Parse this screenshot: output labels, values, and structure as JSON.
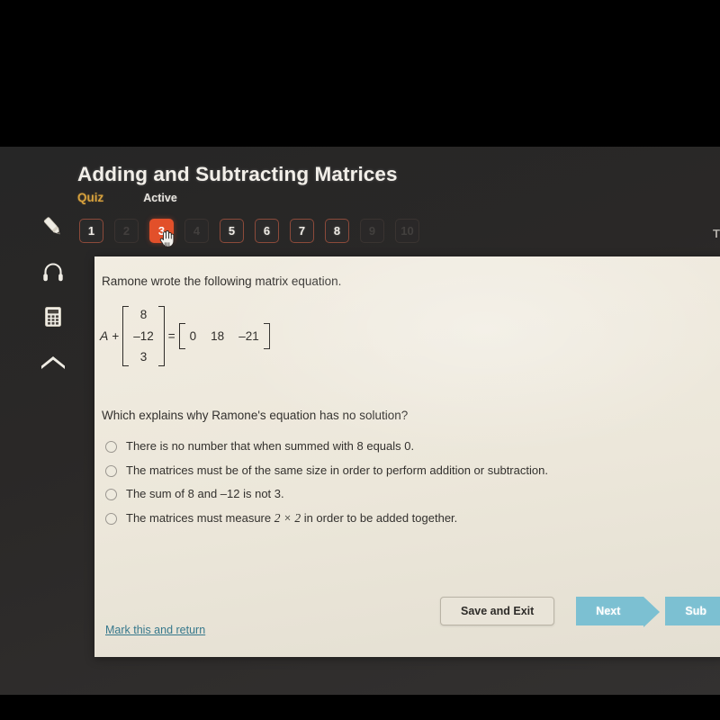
{
  "header": {
    "title": "Adding and Subtracting Matrices",
    "quiz_label": "Quiz",
    "status_label": "Active",
    "right_cut_text": "T"
  },
  "colors": {
    "accent_orange": "#e2502a",
    "quiz_amber": "#d7a13d",
    "teal_button": "#7cc0d2",
    "link_teal": "#36788c",
    "panel_cream": "#eeeade",
    "chrome_dark": "#2a2827"
  },
  "tool_rail": {
    "items": [
      {
        "name": "highlighter-tool",
        "icon": "pencil-icon"
      },
      {
        "name": "audio-tool",
        "icon": "headphones-icon"
      },
      {
        "name": "calculator-tool",
        "icon": "calculator-icon"
      },
      {
        "name": "scroll-up-tool",
        "icon": "arrow-up-icon"
      }
    ]
  },
  "pills": [
    {
      "label": "1",
      "state": "avail"
    },
    {
      "label": "2",
      "state": "faded"
    },
    {
      "label": "3",
      "state": "current"
    },
    {
      "label": "4",
      "state": "faded"
    },
    {
      "label": "5",
      "state": "avail"
    },
    {
      "label": "6",
      "state": "avail"
    },
    {
      "label": "7",
      "state": "avail"
    },
    {
      "label": "8",
      "state": "avail"
    },
    {
      "label": "9",
      "state": "faded"
    },
    {
      "label": "10",
      "state": "faded"
    }
  ],
  "content": {
    "prompt": "Ramone wrote the following matrix equation.",
    "equation": {
      "variable": "A",
      "operator": "+",
      "column_matrix": [
        "8",
        "–12",
        "3"
      ],
      "equals": "=",
      "row_matrix": [
        "0",
        "18",
        "–21"
      ]
    },
    "question": "Which explains why Ramone's equation has no solution?",
    "options": [
      {
        "text": "There is no number that when summed with 8 equals 0.",
        "selected": false
      },
      {
        "text": "The matrices must be of the same size in order to perform addition or subtraction.",
        "selected": false
      },
      {
        "text": "The sum of 8 and –12 is not 3.",
        "selected": false
      },
      {
        "text_before": "The matrices must measure ",
        "math": "2 × 2",
        "text_after": " in order to be added together.",
        "selected": false
      }
    ]
  },
  "footer": {
    "mark_return_label": "Mark this and return",
    "save_exit_label": "Save and Exit",
    "next_label": "Next",
    "submit_label": "Sub"
  }
}
